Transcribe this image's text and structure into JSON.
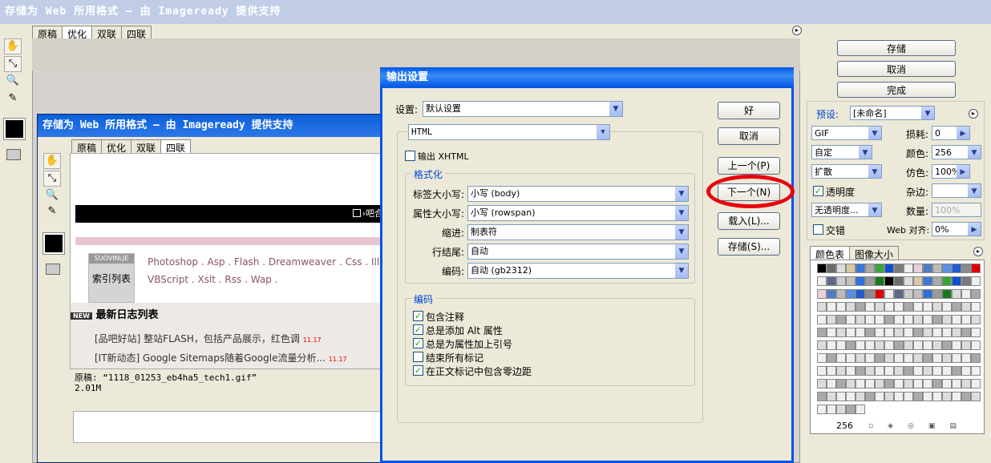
{
  "window_title": "存储为 Web 所用格式 — 由 Imageready 提供支持",
  "main_tabs": [
    "原稿",
    "优化",
    "双联",
    "四联"
  ],
  "tools": [
    {
      "name": "hand-icon",
      "glyph": "✋"
    },
    {
      "name": "slice-select-icon",
      "glyph": "⤡"
    },
    {
      "name": "zoom-icon",
      "glyph": "🔍"
    },
    {
      "name": "eyedropper-icon",
      "glyph": "✎"
    }
  ],
  "right_buttons": {
    "save": "存储",
    "cancel": "取消",
    "done": "完成"
  },
  "presets": {
    "label": "预设:",
    "value": "[未命名]",
    "format": "GIF",
    "lossy_label": "损耗:",
    "lossy_value": "0",
    "palette": "自定",
    "colors_label": "颜色:",
    "colors_value": "256",
    "dither_algo": "扩散",
    "dither_label": "仿色:",
    "dither_value": "100%",
    "transparency_label": "透明度",
    "matte_label": "杂边:",
    "no_transparency_dither": "无透明度...",
    "amount_label": "数量:",
    "amount_value": "100%",
    "interlace_label": "交错",
    "web_snap_label": "Web 对齐:",
    "web_snap_value": "0%"
  },
  "color_tabs": [
    "颜色表",
    "图像大小"
  ],
  "color_count": "256",
  "inner_window": {
    "title": "存储为 Web 所用格式 — 由 Imageready 提供支持",
    "tabs": [
      "原稿",
      "优化",
      "双联",
      "四联"
    ],
    "preview": {
      "blog_links": "Photoshop . Asp . Flash . Dreamweaver . Css . Illustr",
      "blog_links2": "VBScript . Xslt . Rss . Wap .",
      "logo_text": "SUOVINLJE",
      "index_label": "索引列表",
      "banner_right": "吧合",
      "section_title": "最新日志列表",
      "new_badge": "NEW",
      "items": [
        {
          "text": "[品吧好站] 整站FLASH，包括产品展示，红色调",
          "date": "11.17"
        },
        {
          "text": "[IT新动态] Google Sitemaps随着Google流量分析...",
          "date": "11.17"
        }
      ]
    },
    "status_line1": "原稿: “1118_01253_eb4ha5_tech1.gif”",
    "status_line2": "2.01M"
  },
  "dialog": {
    "title": "输出设置",
    "settings_label": "设置:",
    "settings_value": "默认设置",
    "type_value": "HTML",
    "output_xhtml": "输出 XHTML",
    "format_group": "格式化",
    "rows": [
      {
        "label": "标签大小写:",
        "value": "小写 (body)"
      },
      {
        "label": "属性大小写:",
        "value": "小写 (rowspan)"
      },
      {
        "label": "缩进:",
        "value": "制表符"
      },
      {
        "label": "行结尾:",
        "value": "自动"
      },
      {
        "label": "编码:",
        "value": "自动 (gb2312)"
      }
    ],
    "encode_group": "编码",
    "checks": [
      {
        "label": "包含注释",
        "checked": true
      },
      {
        "label": "总是添加 Alt 属性",
        "checked": true
      },
      {
        "label": "总是为属性加上引号",
        "checked": true
      },
      {
        "label": "结束所有标记",
        "checked": false
      },
      {
        "label": "在正文标记中包含零边距",
        "checked": true
      }
    ],
    "buttons": {
      "ok": "好",
      "cancel": "取消",
      "prev": "上一个(P)",
      "next": "下一个(N)",
      "load": "载入(L)...",
      "save": "存储(S)..."
    }
  },
  "colors": {
    "accent_title": "#0a246a",
    "dialog_title": "#0058e6",
    "highlight_circle": "#e8000c"
  }
}
